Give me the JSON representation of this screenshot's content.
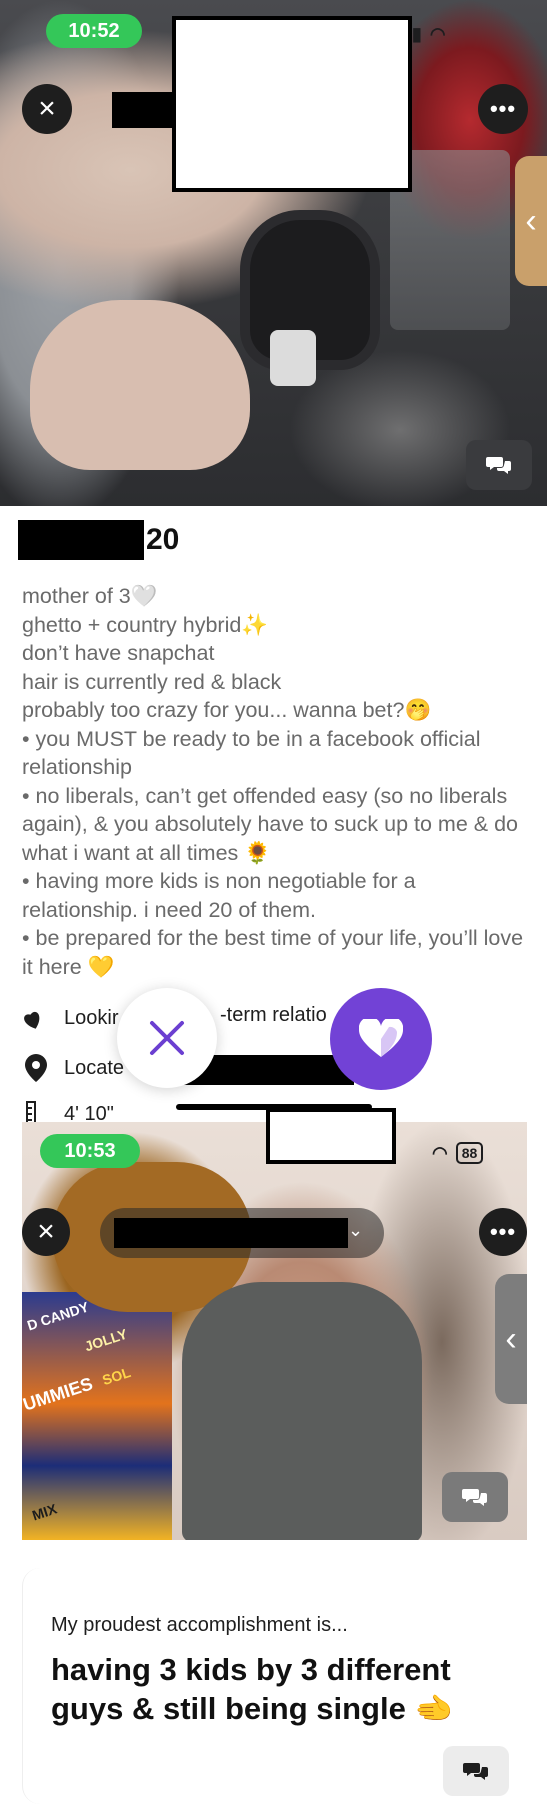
{
  "screen1": {
    "status_time": "10:52",
    "profile_age": "20",
    "bio_lines": [
      "mother of 3🤍",
      "ghetto + country hybrid✨",
      "don’t have snapchat",
      "hair is currently red & black",
      "probably too crazy for you... wanna bet?🤭",
      "• you MUST be ready to be in a facebook official relationship",
      "• no liberals, can’t get offended easy (so no liberals again), & you absolutely have to suck up to me & do what i want at all times 🌻",
      "• having more kids is non negotiable for a relationship. i need 20 of them.",
      "• be prepared for the best time of your life, you’ll love it here 💛"
    ],
    "details": {
      "looking_for_left": "Lookir",
      "looking_for_right": "-term relatio",
      "location": "Locate",
      "height": "4' 10\""
    },
    "icons": {
      "close": "close-icon",
      "more": "more-icon",
      "chat": "chat-icon",
      "pass": "pass-x-icon",
      "like": "heart-icon",
      "collapse": "chevron-left-icon"
    },
    "colors": {
      "status_pill": "#34c759",
      "accent": "#7242d6",
      "bio_text": "#6a6a6a"
    }
  },
  "screen2": {
    "status_time": "10:53",
    "battery": "88",
    "shelf_labels": [
      "D CANDY",
      "JOLLY",
      "UMMIES",
      "SOL",
      "MIX"
    ],
    "prompt_question": "My proudest accomplishment is...",
    "prompt_answer": "having 3 kids by 3 different guys & still being single 🫲"
  }
}
